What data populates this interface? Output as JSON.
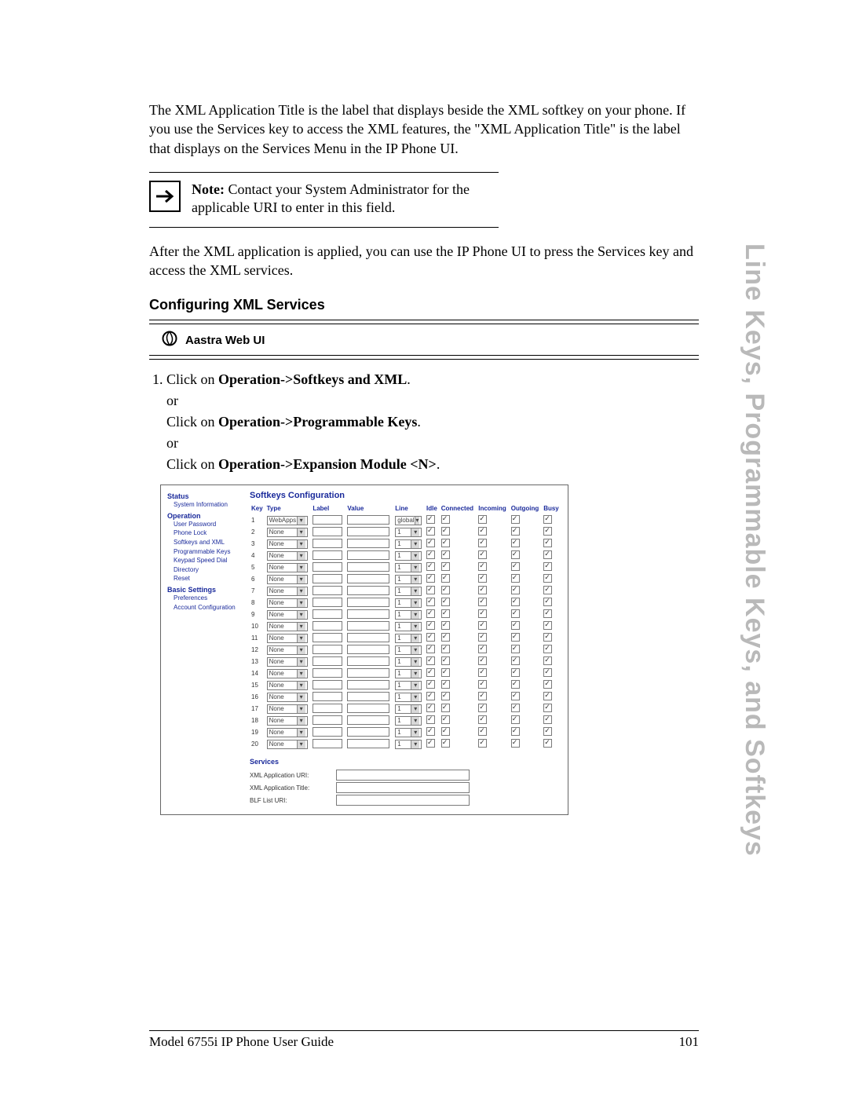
{
  "side_tab": "Line Keys, Programmable Keys, and Softkeys",
  "para1": "The XML Application Title is the label that displays beside the XML softkey on your phone. If you use the Services key to access the XML features, the \"XML Application Title\" is the label that displays on the Services Menu in the IP Phone UI.",
  "note": {
    "label": "Note:",
    "body": "Contact your System Administrator for the applicable URI to enter in this field."
  },
  "para2": "After the XML application is applied, you can use the IP Phone UI to press the Services key and access the XML services.",
  "section_heading": "Configuring XML Services",
  "aastra_title": "Aastra Web UI",
  "step": {
    "line1_pre": "Click on ",
    "line1_bold": "Operation->Softkeys and XML",
    "or": "or",
    "line2_pre": "Click on ",
    "line2_bold": "Operation->Programmable Keys",
    "line3_pre": "Click on ",
    "line3_bold": "Operation->Expansion Module <N>",
    "dot": "."
  },
  "ui": {
    "nav": {
      "status": "Status",
      "sysinfo": "System Information",
      "operation": "Operation",
      "items_op": [
        "User Password",
        "Phone Lock",
        "Softkeys and XML",
        "Programmable Keys",
        "Keypad Speed Dial",
        "Directory",
        "Reset"
      ],
      "basic": "Basic Settings",
      "items_bs": [
        "Preferences",
        "Account Configuration"
      ]
    },
    "title": "Softkeys Configuration",
    "headers": {
      "key": "Key",
      "type": "Type",
      "label": "Label",
      "value": "Value",
      "line": "Line",
      "idle": "Idle",
      "connected": "Connected",
      "incoming": "Incoming",
      "outgoing": "Outgoing",
      "busy": "Busy"
    },
    "type_first": "WebApps",
    "type_other": "None",
    "line_first": "global",
    "line_other": "1",
    "services": {
      "header": "Services",
      "r1": "XML Application URI:",
      "r2": "XML Application Title:",
      "r3": "BLF List URI:"
    }
  },
  "footer": {
    "left": "Model 6755i IP Phone User Guide",
    "right": "101"
  },
  "chart_data": {
    "type": "table",
    "title": "Softkeys Configuration",
    "columns": [
      "Key",
      "Type",
      "Label",
      "Value",
      "Line",
      "Idle",
      "Connected",
      "Incoming",
      "Outgoing",
      "Busy"
    ],
    "rows": [
      {
        "Key": 1,
        "Type": "WebApps",
        "Label": "",
        "Value": "",
        "Line": "global",
        "Idle": true,
        "Connected": true,
        "Incoming": true,
        "Outgoing": true,
        "Busy": true
      },
      {
        "Key": 2,
        "Type": "None",
        "Label": "",
        "Value": "",
        "Line": "1",
        "Idle": true,
        "Connected": true,
        "Incoming": true,
        "Outgoing": true,
        "Busy": true
      },
      {
        "Key": 3,
        "Type": "None",
        "Label": "",
        "Value": "",
        "Line": "1",
        "Idle": true,
        "Connected": true,
        "Incoming": true,
        "Outgoing": true,
        "Busy": true
      },
      {
        "Key": 4,
        "Type": "None",
        "Label": "",
        "Value": "",
        "Line": "1",
        "Idle": true,
        "Connected": true,
        "Incoming": true,
        "Outgoing": true,
        "Busy": true
      },
      {
        "Key": 5,
        "Type": "None",
        "Label": "",
        "Value": "",
        "Line": "1",
        "Idle": true,
        "Connected": true,
        "Incoming": true,
        "Outgoing": true,
        "Busy": true
      },
      {
        "Key": 6,
        "Type": "None",
        "Label": "",
        "Value": "",
        "Line": "1",
        "Idle": true,
        "Connected": true,
        "Incoming": true,
        "Outgoing": true,
        "Busy": true
      },
      {
        "Key": 7,
        "Type": "None",
        "Label": "",
        "Value": "",
        "Line": "1",
        "Idle": true,
        "Connected": true,
        "Incoming": true,
        "Outgoing": true,
        "Busy": true
      },
      {
        "Key": 8,
        "Type": "None",
        "Label": "",
        "Value": "",
        "Line": "1",
        "Idle": true,
        "Connected": true,
        "Incoming": true,
        "Outgoing": true,
        "Busy": true
      },
      {
        "Key": 9,
        "Type": "None",
        "Label": "",
        "Value": "",
        "Line": "1",
        "Idle": true,
        "Connected": true,
        "Incoming": true,
        "Outgoing": true,
        "Busy": true
      },
      {
        "Key": 10,
        "Type": "None",
        "Label": "",
        "Value": "",
        "Line": "1",
        "Idle": true,
        "Connected": true,
        "Incoming": true,
        "Outgoing": true,
        "Busy": true
      },
      {
        "Key": 11,
        "Type": "None",
        "Label": "",
        "Value": "",
        "Line": "1",
        "Idle": true,
        "Connected": true,
        "Incoming": true,
        "Outgoing": true,
        "Busy": true
      },
      {
        "Key": 12,
        "Type": "None",
        "Label": "",
        "Value": "",
        "Line": "1",
        "Idle": true,
        "Connected": true,
        "Incoming": true,
        "Outgoing": true,
        "Busy": true
      },
      {
        "Key": 13,
        "Type": "None",
        "Label": "",
        "Value": "",
        "Line": "1",
        "Idle": true,
        "Connected": true,
        "Incoming": true,
        "Outgoing": true,
        "Busy": true
      },
      {
        "Key": 14,
        "Type": "None",
        "Label": "",
        "Value": "",
        "Line": "1",
        "Idle": true,
        "Connected": true,
        "Incoming": true,
        "Outgoing": true,
        "Busy": true
      },
      {
        "Key": 15,
        "Type": "None",
        "Label": "",
        "Value": "",
        "Line": "1",
        "Idle": true,
        "Connected": true,
        "Incoming": true,
        "Outgoing": true,
        "Busy": true
      },
      {
        "Key": 16,
        "Type": "None",
        "Label": "",
        "Value": "",
        "Line": "1",
        "Idle": true,
        "Connected": true,
        "Incoming": true,
        "Outgoing": true,
        "Busy": true
      },
      {
        "Key": 17,
        "Type": "None",
        "Label": "",
        "Value": "",
        "Line": "1",
        "Idle": true,
        "Connected": true,
        "Incoming": true,
        "Outgoing": true,
        "Busy": true
      },
      {
        "Key": 18,
        "Type": "None",
        "Label": "",
        "Value": "",
        "Line": "1",
        "Idle": true,
        "Connected": true,
        "Incoming": true,
        "Outgoing": true,
        "Busy": true
      },
      {
        "Key": 19,
        "Type": "None",
        "Label": "",
        "Value": "",
        "Line": "1",
        "Idle": true,
        "Connected": true,
        "Incoming": true,
        "Outgoing": true,
        "Busy": true
      },
      {
        "Key": 20,
        "Type": "None",
        "Label": "",
        "Value": "",
        "Line": "1",
        "Idle": true,
        "Connected": true,
        "Incoming": true,
        "Outgoing": true,
        "Busy": true
      }
    ]
  }
}
